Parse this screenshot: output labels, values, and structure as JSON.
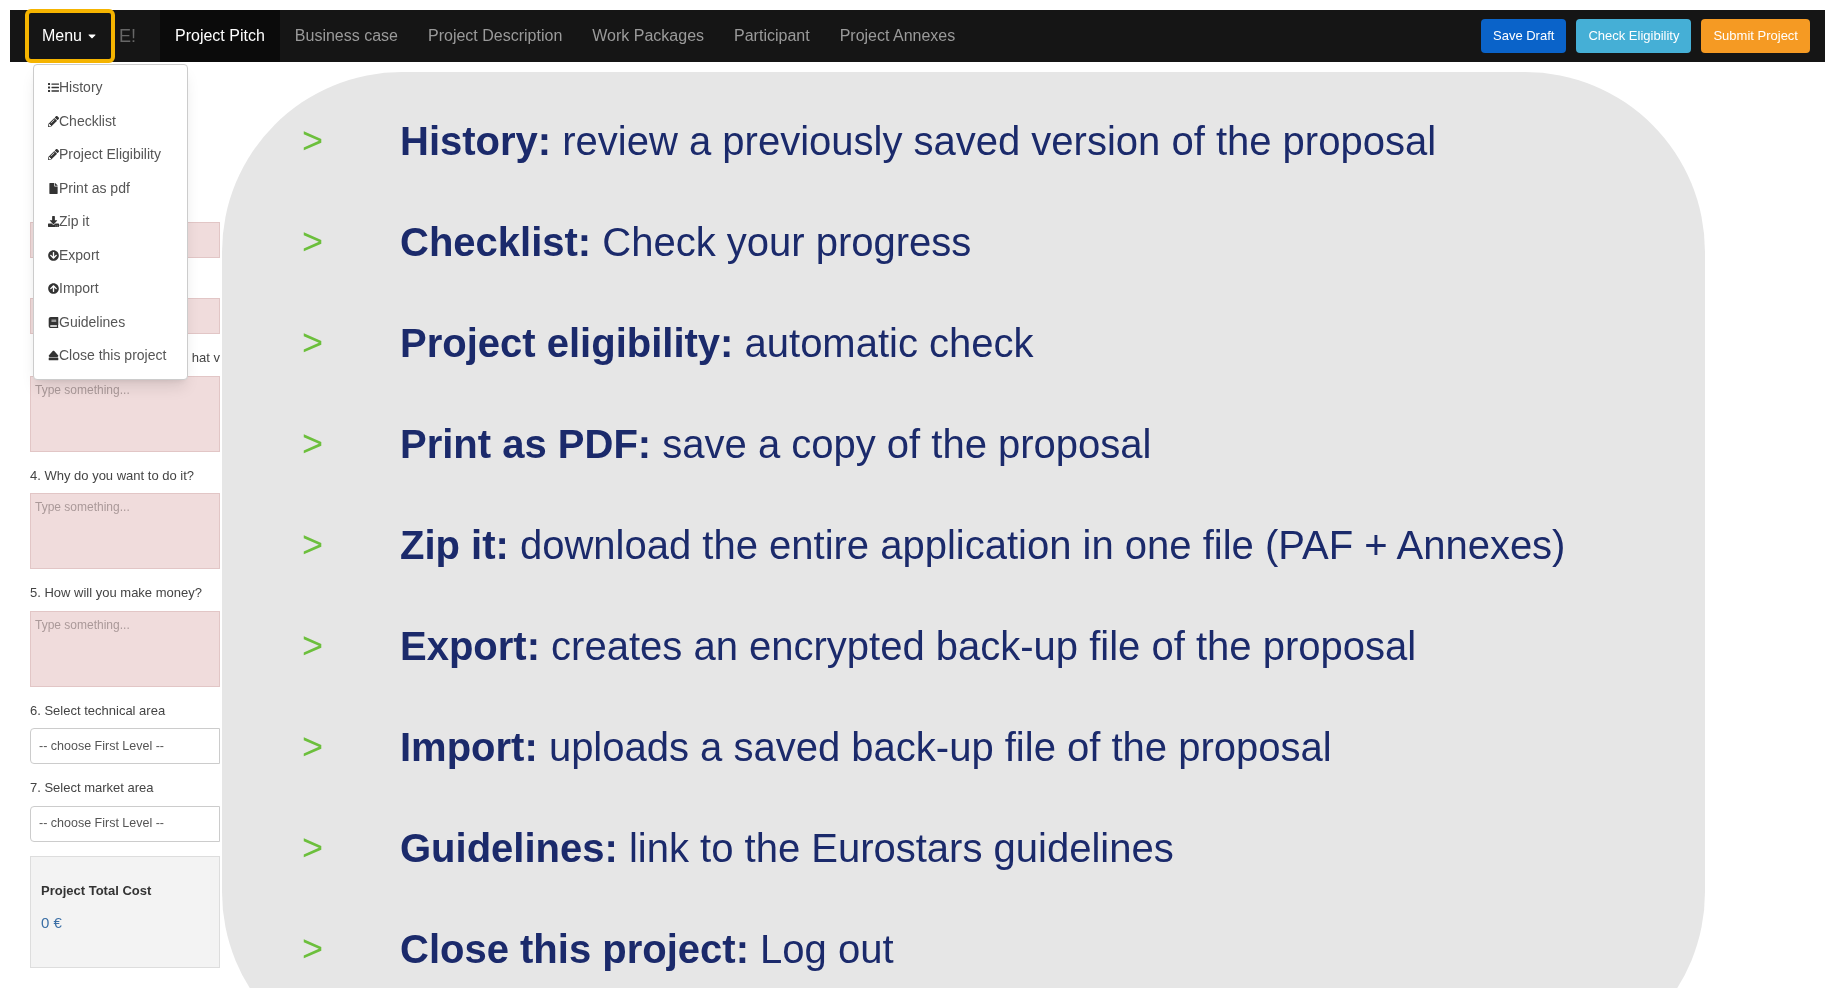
{
  "navbar": {
    "menu_button": {
      "label": "Menu",
      "highlighted": true
    },
    "brand_partial": "E!",
    "tabs": [
      {
        "label": "Project Pitch",
        "selected": true
      },
      {
        "label": "Business case",
        "selected": false
      },
      {
        "label": "Project Description",
        "selected": false
      },
      {
        "label": "Work Packages",
        "selected": false
      },
      {
        "label": "Participant",
        "selected": false
      },
      {
        "label": "Project Annexes",
        "selected": false
      }
    ],
    "buttons": [
      {
        "label": "Save Draft",
        "color": "#0a63c9"
      },
      {
        "label": "Check Eligibility",
        "color": "#45afd6"
      },
      {
        "label": "Submit Project",
        "color": "#f59a23"
      }
    ]
  },
  "menu_dropdown": {
    "items": [
      "History",
      "Checklist",
      "Project Eligibility",
      "Print as pdf",
      "Zip it",
      "Export",
      "Import",
      "Guidelines",
      "Close this project"
    ]
  },
  "form": {
    "items": [
      {
        "kind": "textarea"
      },
      {
        "kind": "textarea"
      },
      {
        "kind": "label",
        "text": "hat v"
      },
      {
        "kind": "textarea",
        "placeholder": "Type something..."
      },
      {
        "kind": "label",
        "text": "4. Why do you want to do it?"
      },
      {
        "kind": "textarea",
        "placeholder": "Type something..."
      },
      {
        "kind": "label",
        "text": "5. How will you make money?"
      },
      {
        "kind": "textarea",
        "placeholder": "Type something..."
      },
      {
        "kind": "label",
        "text": "6. Select technical area"
      },
      {
        "kind": "select",
        "value": "-- choose First Level --"
      },
      {
        "kind": "label",
        "text": "7. Select market area"
      },
      {
        "kind": "select",
        "value": "-- choose First Level --"
      }
    ],
    "total_cost": {
      "label": "Project Total Cost",
      "value": "0 €"
    }
  },
  "callout": {
    "marker": ">",
    "items": [
      "**History:** review a previously saved version of the proposal",
      "**Checklist:** Check your progress",
      "**Project eligibility:** automatic check",
      "**Print as PDF:** save a copy of the proposal",
      "**Zip it:** download the entire application in one file (PAF + Annexes)",
      "**Export:** creates an encrypted back-up file of the proposal",
      "**Import:** uploads a saved back-up file of the proposal",
      "**Guidelines:** link to the Eurostars guidelines",
      "**Close this project:** Log out"
    ]
  }
}
